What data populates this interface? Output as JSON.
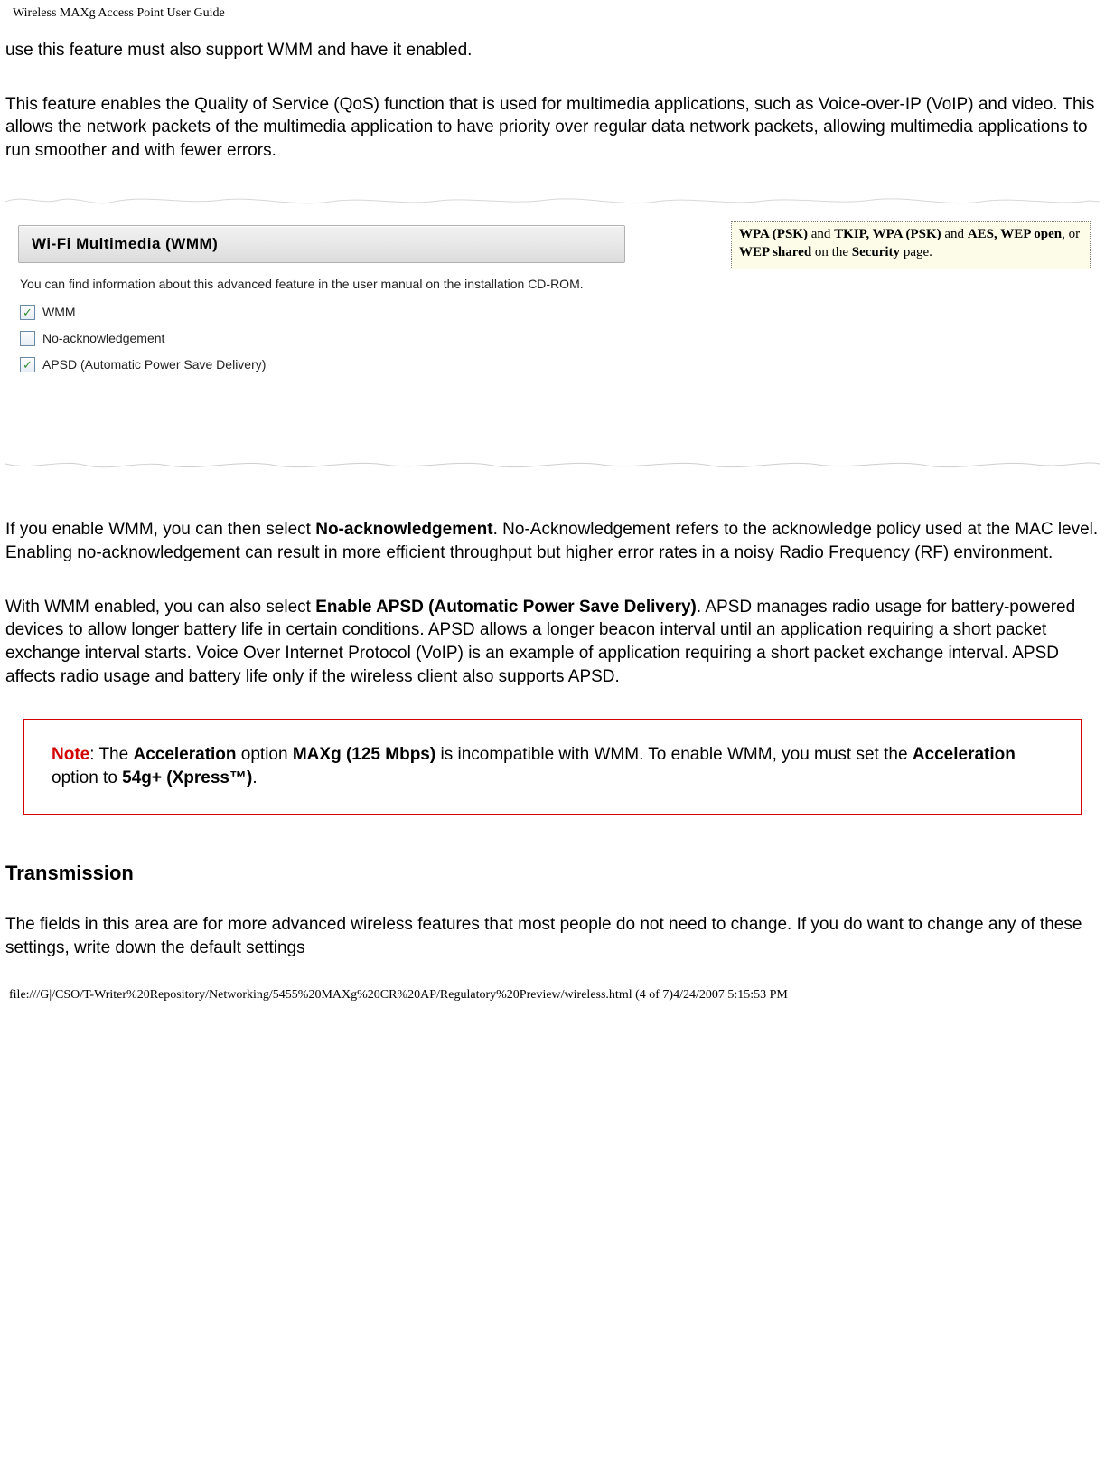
{
  "header": "Wireless MAXg Access Point User Guide",
  "para1": "use this feature must also support WMM and have it enabled.",
  "para2": "This feature enables the Quality of Service (QoS) function that is used for multimedia applications, such as Voice-over-IP (VoIP) and video. This allows the network packets of the multimedia application to have priority over regular data network packets, allowing multimedia applications to run smoother and with fewer errors.",
  "screenshot": {
    "title": "Wi-Fi Multimedia (WMM)",
    "tooltip_parts": {
      "p1": "WPA (PSK)",
      "p2": " and ",
      "p3": "TKIP, WPA (PSK)",
      "p4": " and ",
      "p5": "AES, WEP open",
      "p6": ", or ",
      "p7": "WEP shared",
      "p8": " on the ",
      "p9": "Security",
      "p10": " page."
    },
    "desc": "You can find information about this advanced feature in the user manual on the installation CD-ROM.",
    "cb1": "WMM",
    "cb2": "No-acknowledgement",
    "cb3": "APSD (Automatic Power Save Delivery)"
  },
  "para3": {
    "t1": "If you enable WMM, you can then select ",
    "b1": "No-acknowledgement",
    "t2": ". No-Acknowledgement refers to the acknowledge policy used at the MAC level. Enabling no-acknowledgement can result in more efficient throughput but higher error rates in a noisy Radio Frequency (RF) environment."
  },
  "para4": {
    "t1": "With WMM enabled, you can also select ",
    "b1": "Enable APSD (Automatic Power Save Delivery)",
    "t2": ". APSD manages radio usage for battery-powered devices to allow longer battery life in certain conditions. APSD allows a longer beacon interval until an application requiring a short packet exchange interval starts. Voice Over Internet Protocol (VoIP) is an example of application requiring a short packet exchange interval. APSD affects radio usage and battery life only if the wireless client also supports APSD."
  },
  "note": {
    "label": "Note",
    "t1": ": The ",
    "b1": "Acceleration",
    "t2": " option ",
    "b2": "MAXg (125 Mbps)",
    "t3": " is incompatible with WMM. To enable WMM, you must set the ",
    "b3": "Acceleration",
    "t4": " option to ",
    "b4": "54g+ (Xpress™)",
    "t5": "."
  },
  "subhead": "Transmission",
  "para5": "The fields in this area are for more advanced wireless features that most people do not need to change. If you do want to change any of these settings, write down the default settings",
  "footer": "file:///G|/CSO/T-Writer%20Repository/Networking/5455%20MAXg%20CR%20AP/Regulatory%20Preview/wireless.html (4 of 7)4/24/2007 5:15:53 PM"
}
